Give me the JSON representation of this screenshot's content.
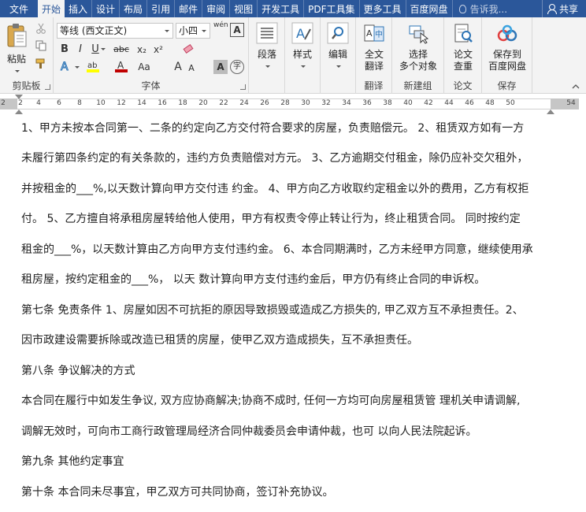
{
  "tabs": [
    "文件",
    "开始",
    "插入",
    "设计",
    "布局",
    "引用",
    "邮件",
    "审阅",
    "视图",
    "开发工具",
    "PDF工具集",
    "更多工具",
    "百度网盘"
  ],
  "active_tab": "开始",
  "tell_me": "告诉我...",
  "share": "共享",
  "ribbon": {
    "clipboard": {
      "paste": "粘贴",
      "label": "剪贴板"
    },
    "font": {
      "font_name": "等线 (西文正文)",
      "font_size": "小四",
      "wen": "wén",
      "bold": "B",
      "italic": "I",
      "underline": "U",
      "strike": "abc",
      "subscript": "x₂",
      "superscript": "x²",
      "grow": "A",
      "shrink": "A",
      "case": "Aa",
      "label": "字体"
    },
    "paragraph": {
      "label": "段落"
    },
    "styles": {
      "label": "样式"
    },
    "editing": {
      "label": "编辑"
    },
    "translate": {
      "btn": [
        "全文",
        "翻译"
      ],
      "label": "翻译"
    },
    "select": {
      "btn": [
        "选择",
        "多个对象"
      ],
      "label": "新建组"
    },
    "paper": {
      "btn": [
        "论文",
        "查重"
      ],
      "label": "论文"
    },
    "save": {
      "btn": [
        "保存到",
        "百度网盘"
      ],
      "label": "保存"
    }
  },
  "ruler": {
    "ticks": [
      "2",
      "2",
      "4",
      "6",
      "8",
      "10",
      "12",
      "14",
      "16",
      "18",
      "20",
      "22",
      "24",
      "26",
      "28",
      "30",
      "32",
      "34",
      "36",
      "38",
      "40",
      "42",
      "44",
      "46",
      "48",
      "50",
      "54"
    ]
  },
  "document": {
    "lines": [
      "  1、甲方未按本合同第一、二条的约定向乙方交付符合要求的房屋，负责赔偿元。 2、租赁双方如有一方",
      "未履行第四条约定的有关条款的，违约方负责赔偿对方元。 3、乙方逾期交付租金，除仍应补交欠租外，",
      "并按租金的___%,以天数计算向甲方交付违  约金。 4、甲方向乙方收取约定租金以外的费用，乙方有权拒",
      "付。 5、乙方擅自将承租房屋转给他人使用，甲方有权责令停止转让行为，终止租赁合同。 同时按约定",
      "租金的___%，以天数计算由乙方向甲方支付违约金。  6、本合同期满时，乙方未经甲方同意，继续使用承",
      "租房屋，按约定租金的___%， 以天  数计算向甲方支付违约金后，甲方仍有终止合同的申诉权。",
      "第七条  免责条件 1、房屋如因不可抗拒的原因导致损毁或造成乙方损失的, 甲乙双方互不承担责任。2、",
      "因市政建设需要拆除或改造已租赁的房屋，使甲乙双方造成损失，互不承担责任。",
      "第八条  争议解决的方式",
      "本合同在履行中如发生争议, 双方应协商解决;协商不成时, 任何一方均可向房屋租赁管  理机关申请调解,",
      "调解无效时，可向市工商行政管理局经济合同仲裁委员会申请仲裁，也可  以向人民法院起诉。",
      "第九条  其他约定事宜",
      "第十条  本合同未尽事宜，甲乙双方可共同协商，签订补充协议。"
    ]
  },
  "colors": {
    "brand": "#2b579a",
    "ribbon_bg": "#f3f3f3",
    "text": "#222222"
  }
}
